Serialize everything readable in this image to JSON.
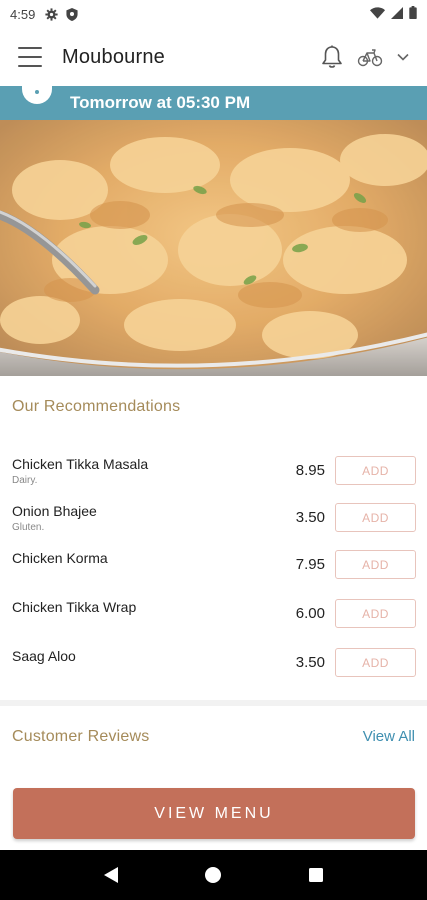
{
  "status_bar": {
    "time": "4:59",
    "icons": [
      "gear-icon",
      "shield-icon",
      "wifi-icon",
      "signal-icon",
      "battery-icon"
    ]
  },
  "app_bar": {
    "title": "Moubourne",
    "icons": [
      "menu-icon",
      "bell-icon",
      "bike-icon",
      "chevron-down-icon"
    ]
  },
  "banner": {
    "text": "Tomorrow at 05:30 PM",
    "icon": "location-pin-icon",
    "color": "#5a9fb3"
  },
  "recommendations": {
    "title": "Our Recommendations",
    "add_label": "ADD",
    "items": [
      {
        "name": "Chicken Tikka Masala",
        "tag": "Dairy.",
        "price": "8.95"
      },
      {
        "name": "Onion Bhajee",
        "tag": "Gluten.",
        "price": "3.50"
      },
      {
        "name": "Chicken Korma",
        "tag": "",
        "price": "7.95"
      },
      {
        "name": "Chicken Tikka Wrap",
        "tag": "",
        "price": "6.00"
      },
      {
        "name": "Saag Aloo",
        "tag": "",
        "price": "3.50"
      }
    ]
  },
  "reviews": {
    "title": "Customer Reviews",
    "view_all": "View All"
  },
  "view_menu": {
    "label": "VIEW MENU",
    "color": "#c3705a"
  },
  "nav_bar": {
    "icons": [
      "back-icon",
      "home-icon",
      "recents-icon"
    ]
  },
  "colors": {
    "accent_gold": "#a58b5a",
    "link_blue": "#3f8fb0",
    "add_border": "#e8c4bc"
  }
}
